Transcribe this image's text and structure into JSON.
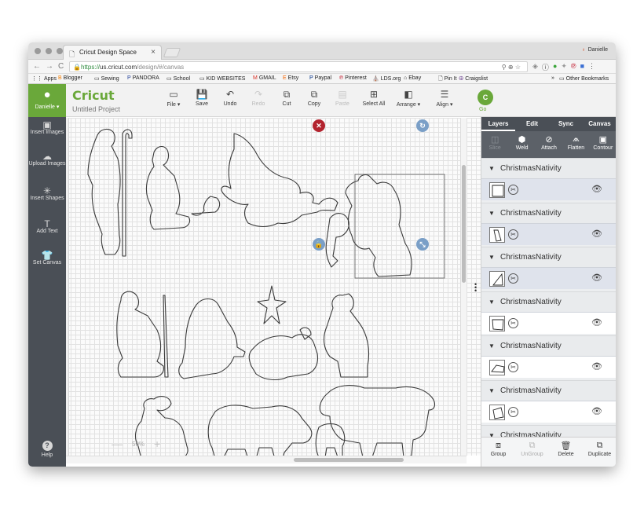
{
  "browser": {
    "tab_title": "Cricut Design Space",
    "tab_close": "×",
    "profile_name": "Danielle",
    "url_scheme": "https://",
    "url_host": "us.cricut.com",
    "url_path": "/design/#/canvas",
    "bookmarks": [
      {
        "label": "Apps",
        "icon": "apps-grid-icon"
      },
      {
        "label": "Blogger",
        "icon": "blogger-icon",
        "color": "#f57d00"
      },
      {
        "label": "Sewing",
        "icon": "folder-icon"
      },
      {
        "label": "PANDORA",
        "icon": "pandora-icon",
        "color": "#224099"
      },
      {
        "label": "School",
        "icon": "folder-icon"
      },
      {
        "label": "KID WEBSITES",
        "icon": "folder-icon"
      },
      {
        "label": "GMAIL",
        "icon": "gmail-icon",
        "color": "#d93025"
      },
      {
        "label": "Etsy",
        "icon": "etsy-icon",
        "color": "#f56400"
      },
      {
        "label": "Paypal",
        "icon": "paypal-icon",
        "color": "#003087"
      },
      {
        "label": "Pinterest",
        "icon": "pinterest-icon",
        "color": "#bd081c"
      },
      {
        "label": "LDS.org",
        "icon": "lds-icon"
      },
      {
        "label": "Ebay",
        "icon": "ebay-icon"
      },
      {
        "label": "Pin It",
        "icon": "page-icon"
      },
      {
        "label": "Craigslist",
        "icon": "peace-icon",
        "color": "#5b2c83"
      }
    ],
    "bookmarks_more": "»",
    "other_bookmarks": "Other Bookmarks"
  },
  "app": {
    "user_name": "Danielle",
    "logo": "Cricut",
    "project_title": "Untitled Project",
    "accent_color": "#6aa83a",
    "toolbar": [
      {
        "label": "File",
        "icon": "folder-icon",
        "caret": true,
        "enabled": true
      },
      {
        "label": "Save",
        "icon": "save-icon",
        "enabled": true
      },
      {
        "label": "Undo",
        "icon": "undo-icon",
        "enabled": true
      },
      {
        "label": "Redo",
        "icon": "redo-icon",
        "enabled": false
      },
      {
        "label": "Cut",
        "icon": "cut-icon",
        "enabled": true
      },
      {
        "label": "Copy",
        "icon": "copy-icon",
        "enabled": true
      },
      {
        "label": "Paste",
        "icon": "paste-icon",
        "enabled": false
      },
      {
        "label": "Select All",
        "icon": "select-all-icon",
        "enabled": true
      },
      {
        "label": "Arrange",
        "icon": "arrange-icon",
        "caret": true,
        "enabled": true
      },
      {
        "label": "Align",
        "icon": "align-icon",
        "caret": true,
        "enabled": true
      }
    ],
    "go_icon": "C",
    "go_label": "Go"
  },
  "sidebar": {
    "items": [
      {
        "label": "Insert Images",
        "icon": "image-icon"
      },
      {
        "label": "Upload Images",
        "icon": "upload-cloud-icon"
      },
      {
        "label": "Insert Shapes",
        "icon": "shapes-icon"
      },
      {
        "label": "Add Text",
        "icon": "text-icon"
      },
      {
        "label": "Set Canvas",
        "icon": "shirt-icon"
      }
    ],
    "help_label": "Help"
  },
  "canvas": {
    "zoom": "50%",
    "zoom_out": "—",
    "zoom_in": "+"
  },
  "panel": {
    "tabs": [
      "Layers",
      "Edit",
      "Sync",
      "Canvas"
    ],
    "active_tab": "Layers",
    "tools": [
      {
        "label": "Slice",
        "icon": "slice-icon",
        "enabled": false
      },
      {
        "label": "Weld",
        "icon": "weld-icon",
        "enabled": true
      },
      {
        "label": "Attach",
        "icon": "attach-icon",
        "enabled": true
      },
      {
        "label": "Flatten",
        "icon": "flatten-icon",
        "enabled": true
      },
      {
        "label": "Contour",
        "icon": "contour-icon",
        "enabled": true
      }
    ],
    "layers": [
      {
        "name": "ChristmasNativity",
        "selected": true
      },
      {
        "name": "ChristmasNativity",
        "selected": true
      },
      {
        "name": "ChristmasNativity",
        "selected": true
      },
      {
        "name": "ChristmasNativity",
        "selected": false
      },
      {
        "name": "ChristmasNativity",
        "selected": false
      },
      {
        "name": "ChristmasNativity",
        "selected": false
      },
      {
        "name": "ChristmasNativity",
        "selected": false
      }
    ],
    "bottom": [
      {
        "label": "Group",
        "icon": "group-icon",
        "enabled": true
      },
      {
        "label": "UnGroup",
        "icon": "ungroup-icon",
        "enabled": false
      },
      {
        "label": "Delete",
        "icon": "trash-icon",
        "enabled": true
      },
      {
        "label": "Duplicate",
        "icon": "duplicate-icon",
        "enabled": true
      }
    ]
  }
}
